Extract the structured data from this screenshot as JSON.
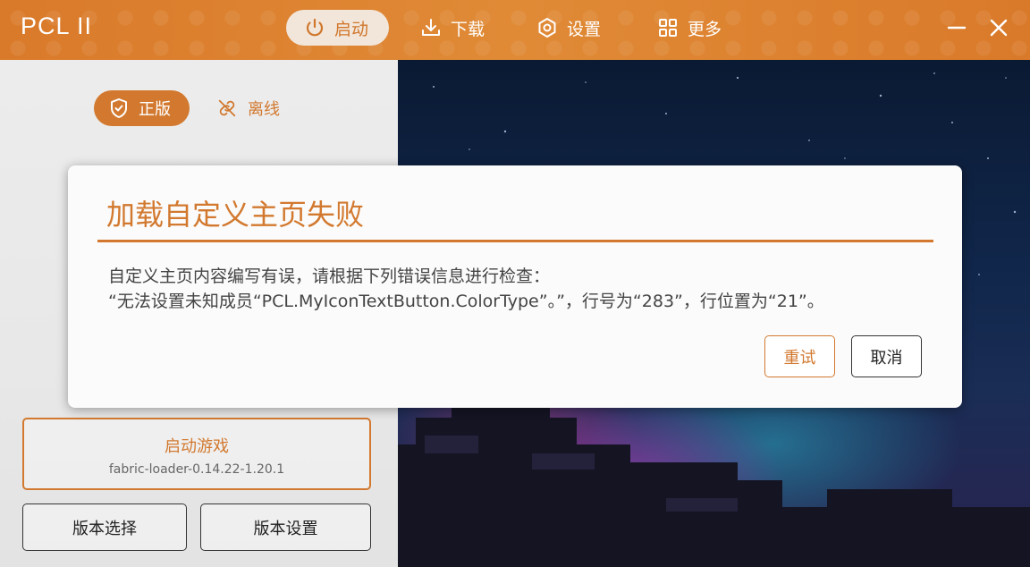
{
  "app": {
    "title": "PCL II"
  },
  "nav": {
    "launch": "启动",
    "download": "下载",
    "settings": "设置",
    "more": "更多"
  },
  "window": {
    "minimize_icon": "minimize-icon",
    "close_icon": "close-icon"
  },
  "account": {
    "official": "正版",
    "offline": "离线"
  },
  "launch": {
    "title": "启动游戏",
    "version": "fabric-loader-0.14.22-1.20.1",
    "select_version": "版本选择",
    "version_settings": "版本设置"
  },
  "dialog": {
    "title": "加载自定义主页失败",
    "line1": "自定义主页内容编写有误，请根据下列错误信息进行检查：",
    "line2": "“无法设置未知成员“PCL.MyIconTextButton.ColorType”。”，行号为“283”，行位置为“21”。",
    "retry": "重试",
    "cancel": "取消"
  },
  "colors": {
    "accent": "#d2792f",
    "titlebar": "#e08a36"
  }
}
